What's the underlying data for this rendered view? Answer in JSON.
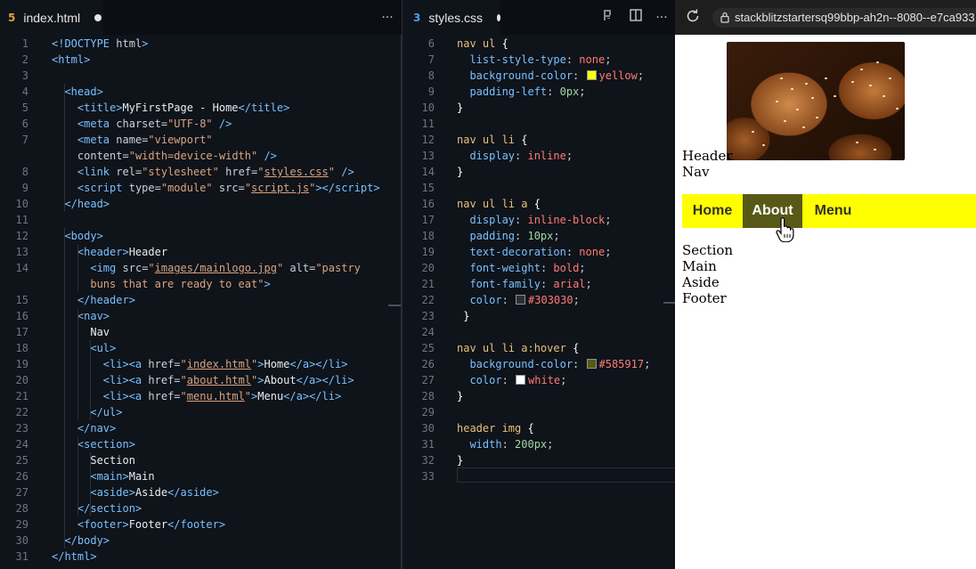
{
  "html_editor": {
    "tab_label": "index.html",
    "tab_icon": "5",
    "more_label": "···",
    "lines": [
      {
        "n": "1",
        "html": "<span class='tg'>&lt;!DOCTYPE</span> <span class='at'>html</span><span class='tg'>&gt;</span>"
      },
      {
        "n": "2",
        "html": "<span class='tg'>&lt;html&gt;</span>"
      },
      {
        "n": "3",
        "html": ""
      },
      {
        "n": "4",
        "html": "  <span class='tg'>&lt;head&gt;</span>"
      },
      {
        "n": "5",
        "html": "    <span class='tg'>&lt;title&gt;</span><span class='t'>MyFirstPage - Home</span><span class='tg'>&lt;/title&gt;</span>"
      },
      {
        "n": "6",
        "html": "    <span class='tg'>&lt;meta</span> <span class='at'>charset</span>=<span class='str'>\"UTF-8\"</span> <span class='tg'>/&gt;</span>"
      },
      {
        "n": "7",
        "html": "    <span class='tg'>&lt;meta</span> <span class='at'>name</span>=<span class='str'>\"viewport\"</span>"
      },
      {
        "n": "",
        "html": "    <span class='at'>content</span>=<span class='str'>\"width=device-width\"</span> <span class='tg'>/&gt;</span>"
      },
      {
        "n": "8",
        "html": "    <span class='tg'>&lt;link</span> <span class='at'>rel</span>=<span class='str'>\"stylesheet\"</span> <span class='at'>href</span>=<span class='str'>\"<span class='u'>styles.css</span>\"</span> <span class='tg'>/&gt;</span>"
      },
      {
        "n": "9",
        "html": "    <span class='tg'>&lt;script</span> <span class='at'>type</span>=<span class='str'>\"module\"</span> <span class='at'>src</span>=<span class='str'>\"<span class='u'>script.js</span>\"</span><span class='tg'>&gt;&lt;/script&gt;</span>"
      },
      {
        "n": "10",
        "html": "  <span class='tg'>&lt;/head&gt;</span>"
      },
      {
        "n": "11",
        "html": ""
      },
      {
        "n": "12",
        "html": "  <span class='tg'>&lt;body&gt;</span>"
      },
      {
        "n": "13",
        "html": "    <span class='tg'>&lt;header&gt;</span><span class='t'>Header</span>"
      },
      {
        "n": "14",
        "html": "      <span class='tg'>&lt;img</span> <span class='at'>src</span>=<span class='str'>\"<span class='u'>images/mainlogo.jpg</span>\"</span> <span class='at'>alt</span>=<span class='str'>\"pastry</span>"
      },
      {
        "n": "",
        "html": "      <span class='str'>buns that are ready to eat\"</span><span class='tg'>&gt;</span>"
      },
      {
        "n": "15",
        "html": "    <span class='tg'>&lt;/header&gt;</span>"
      },
      {
        "n": "16",
        "html": "    <span class='tg'>&lt;nav&gt;</span>"
      },
      {
        "n": "17",
        "html": "      <span class='t'>Nav</span>"
      },
      {
        "n": "18",
        "html": "      <span class='tg'>&lt;ul&gt;</span>"
      },
      {
        "n": "19",
        "html": "        <span class='tg'>&lt;li&gt;&lt;a</span> <span class='at'>href</span>=<span class='str'>\"<span class='u'>index.html</span>\"</span><span class='tg'>&gt;</span><span class='t'>Home</span><span class='tg'>&lt;/a&gt;&lt;/li&gt;</span>"
      },
      {
        "n": "20",
        "html": "        <span class='tg'>&lt;li&gt;&lt;a</span> <span class='at'>href</span>=<span class='str'>\"<span class='u'>about.html</span>\"</span><span class='tg'>&gt;</span><span class='t'>About</span><span class='tg'>&lt;/a&gt;&lt;/li&gt;</span>"
      },
      {
        "n": "21",
        "html": "        <span class='tg'>&lt;li&gt;&lt;a</span> <span class='at'>href</span>=<span class='str'>\"<span class='u'>menu.html</span>\"</span><span class='tg'>&gt;</span><span class='t'>Menu</span><span class='tg'>&lt;/a&gt;&lt;/li&gt;</span>"
      },
      {
        "n": "22",
        "html": "      <span class='tg'>&lt;/ul&gt;</span>"
      },
      {
        "n": "23",
        "html": "    <span class='tg'>&lt;/nav&gt;</span>"
      },
      {
        "n": "24",
        "html": "    <span class='tg'>&lt;section&gt;</span>"
      },
      {
        "n": "25",
        "html": "      <span class='t'>Section</span>"
      },
      {
        "n": "26",
        "html": "      <span class='tg'>&lt;main&gt;</span><span class='t'>Main</span>"
      },
      {
        "n": "27",
        "html": "      <span class='tg'>&lt;aside&gt;</span><span class='t'>Aside</span><span class='tg'>&lt;/aside&gt;</span>"
      },
      {
        "n": "28",
        "html": "    <span class='tg'>&lt;/section&gt;</span>"
      },
      {
        "n": "29",
        "html": "    <span class='tg'>&lt;footer&gt;</span><span class='t'>Footer</span><span class='tg'>&lt;/footer&gt;</span>"
      },
      {
        "n": "30",
        "html": "  <span class='tg'>&lt;/body&gt;</span>"
      },
      {
        "n": "31",
        "html": "<span class='tg'>&lt;/html&gt;</span>"
      }
    ]
  },
  "css_editor": {
    "tab_label": "styles.css",
    "tab_icon": "3",
    "lines": [
      {
        "n": "6",
        "html": "<span class='k'>nav ul</span> <span class='b'>{</span>"
      },
      {
        "n": "7",
        "html": "  <span class='p'>list-style-type</span>: <span class='v'>none</span>;"
      },
      {
        "n": "8",
        "html": "  <span class='p'>background-color</span>: <span class='sw' style='background:#ffff00'></span><span class='v'>yellow</span>;"
      },
      {
        "n": "9",
        "html": "  <span class='p'>padding-left</span>: <span class='n'>0px</span>;"
      },
      {
        "n": "10",
        "html": "<span class='b'>}</span>"
      },
      {
        "n": "11",
        "html": ""
      },
      {
        "n": "12",
        "html": "<span class='k'>nav ul li</span> <span class='b'>{</span>"
      },
      {
        "n": "13",
        "html": "  <span class='p'>display</span>: <span class='v'>inline</span>;"
      },
      {
        "n": "14",
        "html": "<span class='b'>}</span>"
      },
      {
        "n": "15",
        "html": ""
      },
      {
        "n": "16",
        "html": "<span class='k'>nav ul li a</span> <span class='b'>{</span>"
      },
      {
        "n": "17",
        "html": "  <span class='p'>display</span>: <span class='v'>inline-block</span>;"
      },
      {
        "n": "18",
        "html": "  <span class='p'>padding</span>: <span class='n'>10px</span>;"
      },
      {
        "n": "19",
        "html": "  <span class='p'>text-decoration</span>: <span class='v'>none</span>;"
      },
      {
        "n": "20",
        "html": "  <span class='p'>font-weight</span>: <span class='v'>bold</span>;"
      },
      {
        "n": "21",
        "html": "  <span class='p'>font-family</span>: <span class='v'>arial</span>;"
      },
      {
        "n": "22",
        "html": "  <span class='p'>color</span>: <span class='sw' style='background:#303030'></span><span class='v'>#303030</span>;"
      },
      {
        "n": "23",
        "html": " <span class='b'>}</span>"
      },
      {
        "n": "24",
        "html": ""
      },
      {
        "n": "25",
        "html": "<span class='k'>nav ul li a:hover</span> <span class='b'>{</span>"
      },
      {
        "n": "26",
        "html": "  <span class='p'>background-color</span>: <span class='sw' style='background:#585917'></span><span class='v'>#585917</span>;"
      },
      {
        "n": "27",
        "html": "  <span class='p'>color</span>: <span class='sw' style='background:#ffffff'></span><span class='v'>white</span>;"
      },
      {
        "n": "28",
        "html": "<span class='b'>}</span>"
      },
      {
        "n": "29",
        "html": ""
      },
      {
        "n": "30",
        "html": "<span class='k'>header img</span> <span class='b'>{</span>"
      },
      {
        "n": "31",
        "html": "  <span class='p'>width</span>: <span class='n'>200px</span>;"
      },
      {
        "n": "32",
        "html": "<span class='b'>}</span>"
      },
      {
        "n": "33",
        "html": ""
      }
    ]
  },
  "toolbar": {
    "url_text": "stackblitzstartersq99bbp-ah2n--8080--e7ca933",
    "more_label": "···"
  },
  "preview": {
    "header_text": "Header",
    "nav_text": "Nav",
    "nav_links": [
      "Home",
      "About",
      "Menu"
    ],
    "hovered_link": "About",
    "section_text": "Section",
    "main_text": "Main",
    "aside_text": "Aside",
    "footer_text": "Footer",
    "nav_bg": "#ffff00",
    "link_color": "#303030",
    "hover_bg": "#585917",
    "hover_color": "#ffffff"
  }
}
